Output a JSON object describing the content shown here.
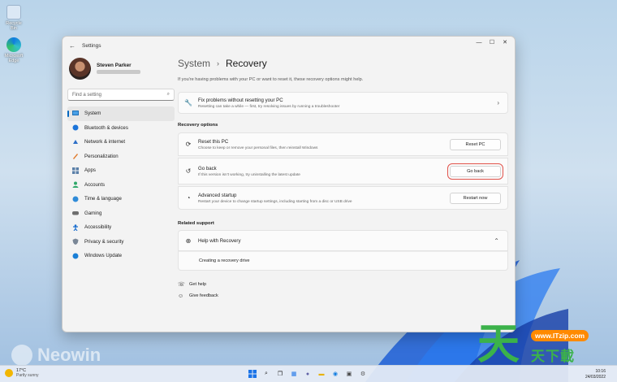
{
  "desktop": {
    "icons": [
      {
        "label": "Recycle Bin",
        "icon": "recycle-bin-icon"
      },
      {
        "label": "Microsoft Edge",
        "icon": "edge-icon"
      }
    ],
    "watermark_neowin": "Neowin",
    "watermark_site": "www.ITzip.com",
    "watermark_glyph": "天",
    "watermark_cn": "天下載"
  },
  "window": {
    "app_title": "Settings",
    "controls": [
      "—",
      "☐",
      "✕"
    ]
  },
  "sidebar": {
    "user_name": "Steven Parker",
    "search_placeholder": "Find a setting",
    "items": [
      {
        "label": "System",
        "icon": "display-icon",
        "active": true
      },
      {
        "label": "Bluetooth & devices",
        "icon": "bluetooth-icon"
      },
      {
        "label": "Network & internet",
        "icon": "wifi-icon"
      },
      {
        "label": "Personalization",
        "icon": "brush-icon"
      },
      {
        "label": "Apps",
        "icon": "apps-icon"
      },
      {
        "label": "Accounts",
        "icon": "person-icon"
      },
      {
        "label": "Time & language",
        "icon": "globe-clock-icon"
      },
      {
        "label": "Gaming",
        "icon": "gamepad-icon"
      },
      {
        "label": "Accessibility",
        "icon": "accessibility-icon"
      },
      {
        "label": "Privacy & security",
        "icon": "shield-icon"
      },
      {
        "label": "Windows Update",
        "icon": "update-icon"
      }
    ]
  },
  "main": {
    "breadcrumb_parent": "System",
    "breadcrumb_current": "Recovery",
    "intro": "If you're having problems with your PC or want to reset it, these recovery options might help.",
    "fix_card": {
      "title": "Fix problems without resetting your PC",
      "desc": "Resetting can take a while — first, try resolving issues by running a troubleshooter"
    },
    "recovery_options_header": "Recovery options",
    "options": [
      {
        "title": "Reset this PC",
        "desc": "Choose to keep or remove your personal files, then reinstall Windows",
        "button": "Reset PC"
      },
      {
        "title": "Go back",
        "desc": "If this version isn't working, try uninstalling the latest update",
        "button": "Go back"
      },
      {
        "title": "Advanced startup",
        "desc": "Restart your device to change startup settings, including starting from a disc or USB drive",
        "button": "Restart now"
      }
    ],
    "related_header": "Related support",
    "help_title": "Help with Recovery",
    "help_link": "Creating a recovery drive",
    "get_help": "Get help",
    "give_feedback": "Give feedback"
  },
  "taskbar": {
    "temp": "17°C",
    "weather": "Partly sunny",
    "time": "10:16",
    "date": "24/03/2022"
  },
  "colors": {
    "accent": "#0067c0",
    "highlight_box": "#e0524a"
  }
}
